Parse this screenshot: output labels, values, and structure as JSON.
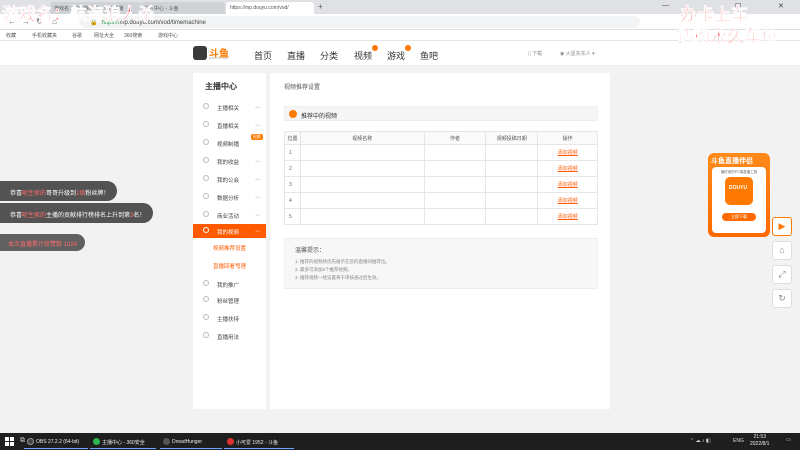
{
  "browser": {
    "tabs": [
      {
        "label": "游戏名：航海狼人杀 - 斗鱼直播"
      },
      {
        "label": "个人中心 - 斗鱼"
      },
      {
        "label": "https://mp.douyu.com/vod/"
      }
    ],
    "url_prefix": "https://",
    "url_rest": "mp.douyu.com/vod/timemachine",
    "bookmarks": [
      "收藏",
      "手机收藏夹",
      "谷歌",
      "网址大全",
      "360搜索",
      "游戏中心"
    ]
  },
  "overlay": {
    "left_title": "游戏名：航海狼人杀",
    "right_line1": "办卡上车",
    "right_line2": "钻粉永久车位",
    "toast1": {
      "pre": "恭喜",
      "name": "昵生家的",
      "mid": "哥哥升级到",
      "level": "1级",
      "post": "粉丝牌！"
    },
    "toast2": {
      "pre": "恭喜",
      "name": "昵生家的",
      "mid": "主播的贡献排行榜排名上升到第",
      "rank": "3",
      "post": "名！"
    },
    "toast3": "本次直播累计获赞数 1024"
  },
  "site": {
    "logo_text": "斗鱼",
    "logo_sub": "DOUYU.COM",
    "nav": [
      {
        "label": "首页"
      },
      {
        "label": "直播"
      },
      {
        "label": "分类"
      },
      {
        "label": "视频"
      },
      {
        "label": "游戏"
      },
      {
        "label": "鱼吧"
      }
    ],
    "download": "下载",
    "user": "火星东东人 ▾"
  },
  "sidebar": {
    "title": "主播中心",
    "items": [
      {
        "label": "主播相关"
      },
      {
        "label": "直播相关"
      },
      {
        "label": "视频制播"
      },
      {
        "label": "我的收益"
      },
      {
        "label": "我的公会"
      },
      {
        "label": "数据分析"
      },
      {
        "label": "商业活动"
      },
      {
        "label": "我的视频"
      },
      {
        "label": "我的推广"
      },
      {
        "label": "粉丝管理"
      },
      {
        "label": "主播扶持"
      },
      {
        "label": "直播用法"
      }
    ],
    "new_tag": "抢鲜",
    "subitems": [
      "视频推荐设置",
      "直播回看管理"
    ]
  },
  "main": {
    "breadcrumb": "视频推荐设置",
    "section_title": "推荐中的视频",
    "table": {
      "headers": [
        "位置",
        "视频名称",
        "作者",
        "视频投稿日期",
        "操作"
      ],
      "rows": [
        {
          "pos": "1",
          "op": "添加视频"
        },
        {
          "pos": "2",
          "op": "添加视频"
        },
        {
          "pos": "3",
          "op": "添加视频"
        },
        {
          "pos": "4",
          "op": "添加视频"
        },
        {
          "pos": "5",
          "op": "添加视频"
        }
      ]
    },
    "tips": {
      "title": "温馨提示：",
      "lines": [
        "1. 推荐的视频将优先展示在您的直播间推荐位。",
        "2. 最多可添加5个推荐视频。",
        "3. 推荐视频一经设置将于审核通过后生效。"
      ]
    }
  },
  "promo": {
    "title": "斗鱼直播伴侣",
    "subtitle": "最好用的PC端直播工具",
    "button": "立即下载"
  },
  "taskbar": {
    "apps": [
      {
        "label": "OBS 27.2.2 (64-bit)",
        "color": "#444444"
      },
      {
        "label": "主播中心 - 360安全",
        "color": "#2db84d"
      },
      {
        "label": "DreadHunger",
        "color": "#555555"
      },
      {
        "label": "小可爱 1952 - 斗鱼",
        "color": "#e03030"
      }
    ],
    "lang": "ENG",
    "time": "21:53",
    "date": "2022/8/1"
  },
  "colors": {
    "accent": "#ff5a00",
    "brand": "#ff7a00"
  }
}
